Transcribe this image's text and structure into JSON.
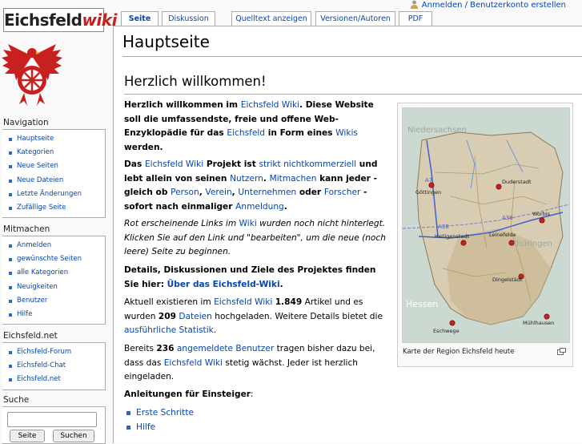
{
  "personal": {
    "login_label": "Anmelden / Benutzerkonto erstellen"
  },
  "logo": {
    "word1": "Eichsfeld",
    "word2": "wiki"
  },
  "tabs": [
    {
      "label": "Seite",
      "selected": true
    },
    {
      "label": "Diskussion"
    },
    {
      "label": "Quelltext anzeigen"
    },
    {
      "label": "Versionen/Autoren"
    },
    {
      "label": "PDF"
    }
  ],
  "sidebar": {
    "navigation": {
      "title": "Navigation",
      "items": [
        "Hauptseite",
        "Kategorien",
        "Neue Seiten",
        "Neue Dateien",
        "Letzte Änderungen",
        "Zufällige Seite"
      ]
    },
    "mitmachen": {
      "title": "Mitmachen",
      "items": [
        "Anmelden",
        "gewünschte Seiten",
        "alle Kategorien",
        "Neuigkeiten",
        "Benutzer",
        "Hilfe"
      ]
    },
    "eichsfeld_net": {
      "title": "Eichsfeld.net",
      "items": [
        "Eichsfeld-Forum",
        "Eichsfeld-Chat",
        "Eichsfeld.net"
      ]
    },
    "search": {
      "title": "Suche",
      "go_label": "Seite",
      "search_label": "Suchen"
    }
  },
  "content": {
    "page_title": "Hauptseite",
    "welcome_heading": "Herzlich willkommen!",
    "p1": {
      "a": "Herzlich willkommen im ",
      "link1": "Eichsfeld Wiki",
      "b": ". Diese Website soll die umfassendste, freie und offene Web-Enzyklopädie für das ",
      "link2": "Eichsfeld",
      "c": " in Form eines ",
      "link3": "Wikis",
      "d": " werden."
    },
    "p2": {
      "a": "Das ",
      "link1": "Eichsfeld Wiki",
      "b": " Projekt ist ",
      "link2": "strikt nichtkommerziell",
      "c": " und lebt allein von seinen ",
      "link3": "Nutzern",
      "d": ". ",
      "link4": "Mitmachen",
      "e": " kann jeder - gleich ob ",
      "link5": "Person",
      "f": ", ",
      "link6": "Verein",
      "g": ", ",
      "link7": "Unternehmen",
      "h": " oder ",
      "link8": "Forscher",
      "i": " - sofort nach einmaliger ",
      "link9": "Anmeldung",
      "j": "."
    },
    "p3": {
      "a": "Rot erscheinende Links im ",
      "link1": "Wiki",
      "b": " wurden noch nicht hinterlegt. Klicken Sie auf den Link und \"bearbeiten\", um die neue (noch leere) Seite zu beginnen."
    },
    "p4": {
      "a": "Details, Diskussionen und Ziele des Projektes finden Sie hier: ",
      "link1": "Über das Eichsfeld-Wiki",
      "b": "."
    },
    "p5": {
      "a": "Aktuell existieren im ",
      "link1": "Eichsfeld Wiki",
      "b": " ",
      "count_articles": "1.849",
      "c": " Artikel und es wurden ",
      "count_files": "209",
      "d": " ",
      "link2": "Dateien",
      "e": " hochgeladen. Weitere Details bietet die ",
      "link3": "ausführliche Statistik",
      "f": "."
    },
    "p6": {
      "a": "Bereits ",
      "count_users": "236",
      "b": " ",
      "link1": "angemeldete Benutzer",
      "c": " tragen bisher dazu bei, dass das ",
      "link2": "Eichsfeld Wiki",
      "d": " stetig wächst. Jeder ist herzlich eingeladen."
    },
    "beginners_heading": "Anleitungen für Einsteiger",
    "beginners_colon": ":",
    "beginner_links": [
      "Erste Schritte",
      "Hilfe"
    ]
  },
  "map": {
    "caption": "Karte der Region Eichsfeld heute",
    "regions": [
      "Niedersachsen",
      "Thüringen",
      "Hessen"
    ],
    "roads": [
      "A7",
      "A38",
      "A38"
    ],
    "towns": [
      "Göttingen",
      "Duderstadt",
      "Worbis",
      "Heiligenstadt",
      "Leinefelde",
      "Dingelstädt",
      "Mühlhausen",
      "Eschwege"
    ]
  }
}
